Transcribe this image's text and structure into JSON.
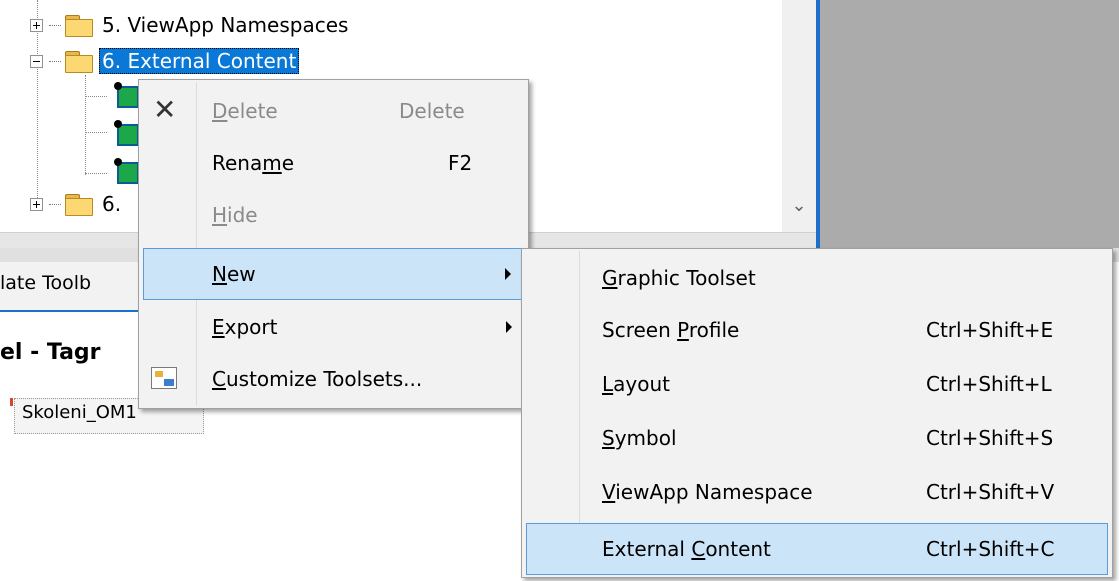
{
  "tree": {
    "nodes": [
      {
        "label": "5. ViewApp Namespaces",
        "expander": "plus"
      },
      {
        "label": "6. External Content",
        "expander": "minus",
        "selected": true
      },
      {
        "label": "6.",
        "expander": "plus"
      }
    ]
  },
  "scroll": {
    "down_glyph": "⌄"
  },
  "lower_panel": {
    "tab_label": "late Toolb",
    "title": "el - Tagr",
    "field_text": "Skoleni_OM1"
  },
  "context_menu": {
    "items": [
      {
        "pre": "",
        "ul": "D",
        "post": "elete",
        "shortcut": "Delete",
        "disabled": true,
        "icon": "delete-x-icon"
      },
      {
        "pre": "Rena",
        "ul": "m",
        "post": "e",
        "shortcut": "F2",
        "disabled": false
      },
      {
        "pre": "",
        "ul": "H",
        "post": "ide",
        "shortcut": "",
        "disabled": true
      },
      {
        "pre": "",
        "ul": "N",
        "post": "ew",
        "shortcut": "",
        "submenu": true,
        "highlighted": true
      },
      {
        "pre": "",
        "ul": "E",
        "post": "xport",
        "shortcut": "",
        "submenu": true
      },
      {
        "pre": "",
        "ul": "C",
        "post": "ustomize Toolsets...",
        "shortcut": "",
        "icon": "customize-toolsets-icon"
      }
    ]
  },
  "submenu": {
    "items": [
      {
        "pre": "",
        "ul": "G",
        "post": "raphic Toolset",
        "shortcut": ""
      },
      {
        "pre": "Screen ",
        "ul": "P",
        "post": "rofile",
        "shortcut": "Ctrl+Shift+E"
      },
      {
        "pre": "",
        "ul": "L",
        "post": "ayout",
        "shortcut": "Ctrl+Shift+L"
      },
      {
        "pre": "",
        "ul": "S",
        "post": "ymbol",
        "shortcut": "Ctrl+Shift+S"
      },
      {
        "pre": "",
        "ul": "V",
        "post": "iewApp Namespace",
        "shortcut": "Ctrl+Shift+V"
      },
      {
        "pre": "External ",
        "ul": "C",
        "post": "ontent",
        "shortcut": "Ctrl+Shift+C",
        "highlighted": true
      }
    ]
  },
  "colors": {
    "selection": "#0a78d7",
    "menu_highlight": "#cce4f7",
    "frame_blue": "#1e6fc9"
  }
}
